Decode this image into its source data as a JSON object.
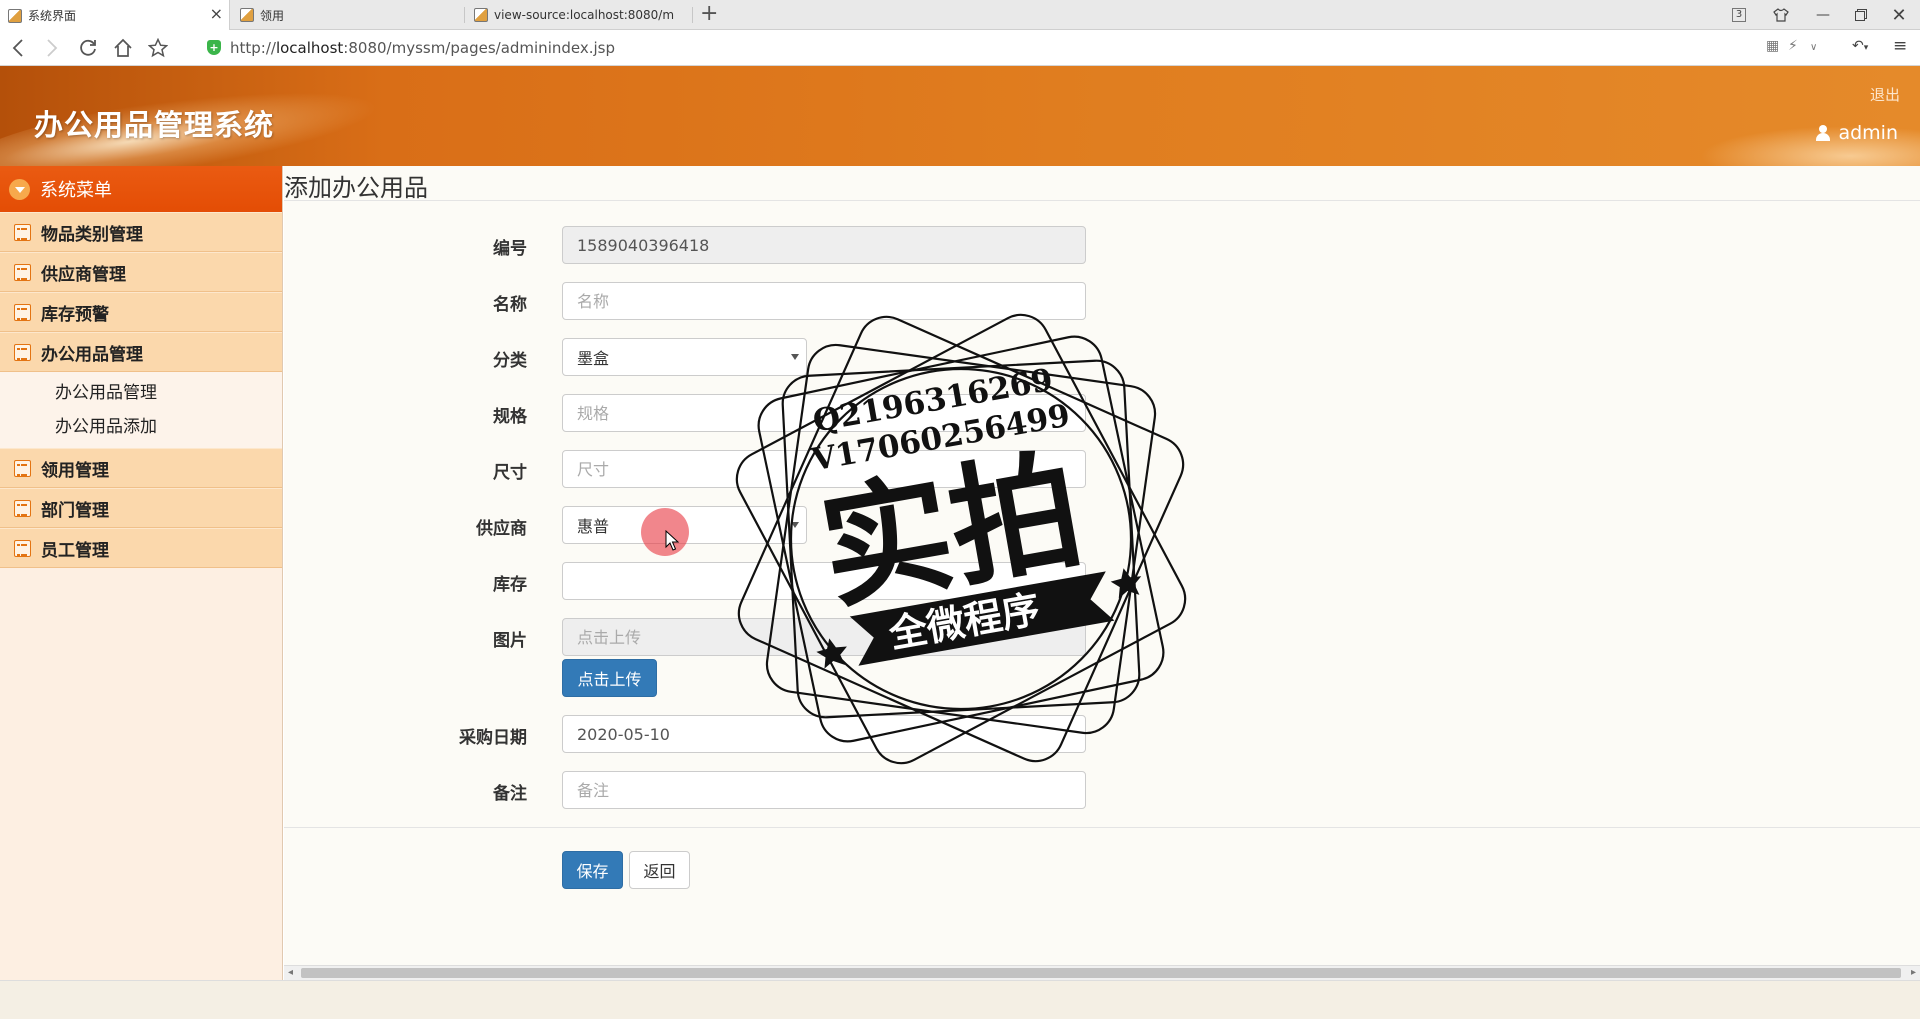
{
  "browser": {
    "tabs": [
      {
        "label": "系统界面",
        "active": true
      },
      {
        "label": "领用",
        "active": false
      },
      {
        "label": "view-source:localhost:8080/m",
        "active": false
      }
    ],
    "tab_count": "3",
    "url_prefix": "http://",
    "url_host": "localhost",
    "url_rest": ":8080/myssm/pages/adminindex.jsp"
  },
  "header": {
    "title": "办公用品管理系统",
    "logout": "退出",
    "user": "admin"
  },
  "sidebar": {
    "heading": "系统菜单",
    "items": [
      {
        "label": "物品类别管理"
      },
      {
        "label": "供应商管理"
      },
      {
        "label": "库存预警"
      },
      {
        "label": "办公用品管理"
      },
      {
        "label": "领用管理"
      },
      {
        "label": "部门管理"
      },
      {
        "label": "员工管理"
      }
    ],
    "submenu": [
      "办公用品管理",
      "办公用品添加"
    ]
  },
  "main": {
    "title": "添加办公用品",
    "fields": {
      "code": {
        "label": "编号",
        "value": "1589040396418"
      },
      "name": {
        "label": "名称",
        "placeholder": "名称"
      },
      "category": {
        "label": "分类",
        "value": "墨盒"
      },
      "spec": {
        "label": "规格",
        "placeholder": "规格"
      },
      "size": {
        "label": "尺寸",
        "placeholder": "尺寸"
      },
      "supplier": {
        "label": "供应商",
        "value": "惠普"
      },
      "stock": {
        "label": "库存",
        "value": ""
      },
      "image": {
        "label": "图片",
        "placeholder": "点击上传",
        "upload_button": "点击上传"
      },
      "purchase_date": {
        "label": "采购日期",
        "value": "2020-05-10"
      },
      "remark": {
        "label": "备注",
        "placeholder": "备注"
      }
    },
    "save_button": "保存",
    "back_button": "返回"
  },
  "watermark": {
    "line1": "Q2196316269",
    "line2": "V17060256499",
    "big": "实拍",
    "banner": "全微程序"
  },
  "colors": {
    "header_orange": "#e07d1f",
    "sidebar_head": "#e44d05",
    "primary_button": "#337ab7"
  }
}
